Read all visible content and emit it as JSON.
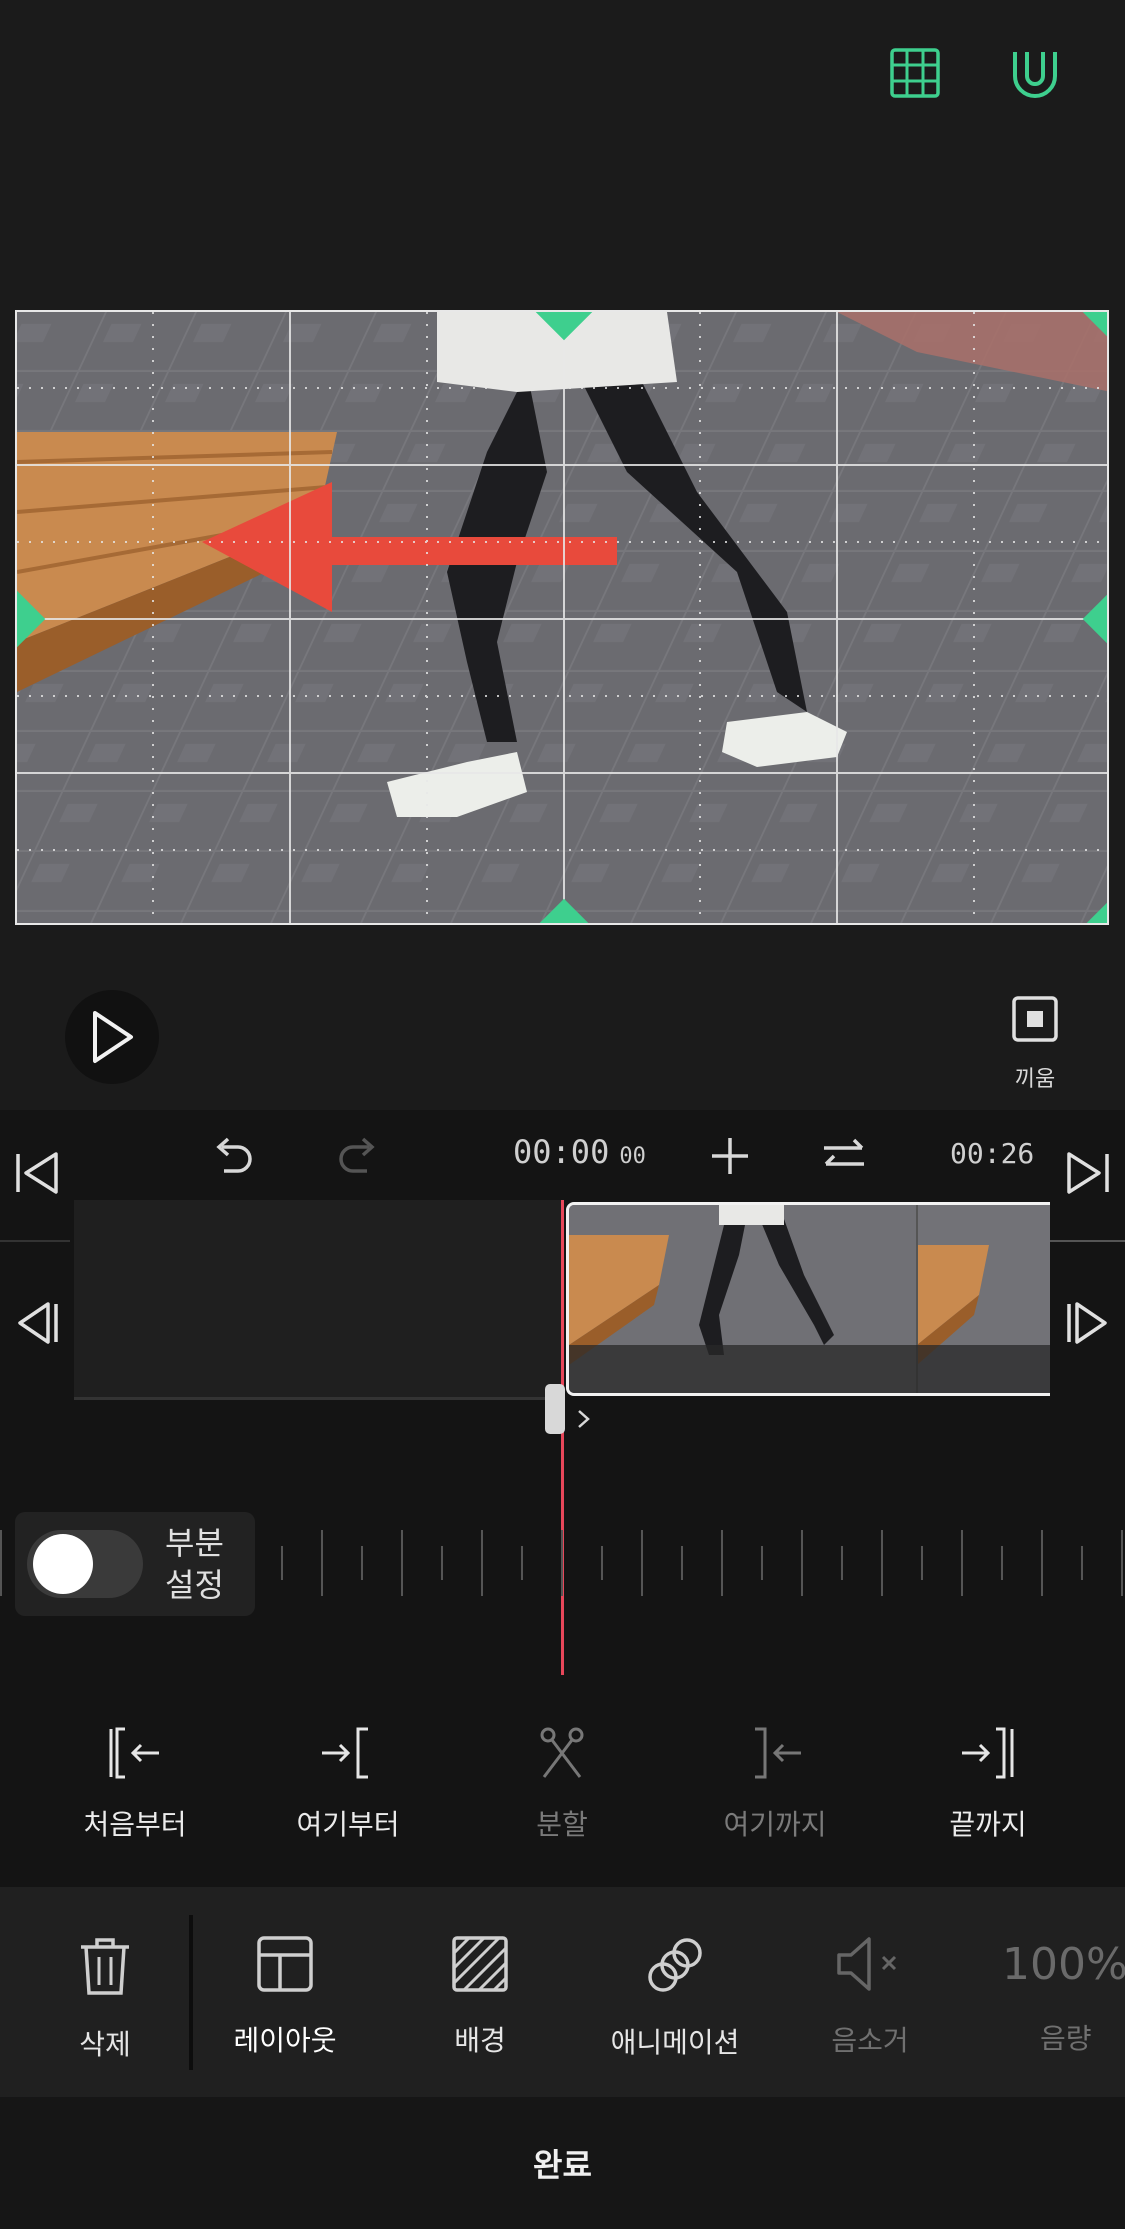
{
  "colors": {
    "accent": "#3ecf8e",
    "playhead": "#e8475a",
    "arrow": "#e84a3c"
  },
  "top_bar": {
    "grid_icon": "grid-icon",
    "magnet_icon": "magnet-icon"
  },
  "playback": {
    "play_icon": "play-icon",
    "fill_label": "끼움"
  },
  "timeline": {
    "current_time": "00:00",
    "current_frames": "00",
    "end_time": "00:26"
  },
  "partial_setting": {
    "label": "부분\n설정",
    "enabled": false
  },
  "trim_tools": [
    {
      "label": "처음부터"
    },
    {
      "label": "여기부터"
    },
    {
      "label": "분할"
    },
    {
      "label": "여기까지"
    },
    {
      "label": "끝까지"
    }
  ],
  "bottom_tools": [
    {
      "label": "삭제"
    },
    {
      "label": "레이아웃"
    },
    {
      "label": "배경"
    },
    {
      "label": "애니메이션"
    },
    {
      "label": "음소거"
    },
    {
      "label": "음량",
      "value": "100%"
    }
  ],
  "done_label": "완료"
}
